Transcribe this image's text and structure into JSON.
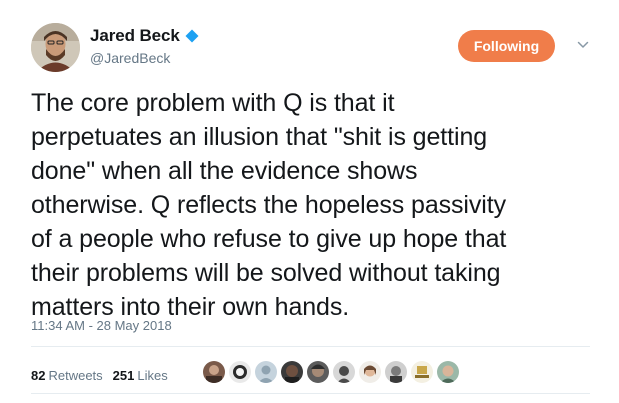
{
  "user": {
    "display_name": "Jared Beck",
    "handle": "@JaredBeck",
    "verified": true
  },
  "follow_button": {
    "label": "Following"
  },
  "tweet": {
    "text": "The core problem with Q is that it\nperpetuates an illusion that \"shit is getting\ndone\" when all the evidence shows\notherwise. Q reflects the hopeless passivity\nof a people who refuse to give up hope that\ntheir problems will be solved without taking\nmatters into their own hands.",
    "timestamp": "11:34 AM - 28 May 2018"
  },
  "stats": {
    "retweets_count": "82",
    "retweets_label": "Retweets",
    "likes_count": "251",
    "likes_label": "Likes"
  },
  "colors": {
    "follow_button": "#f07d4a",
    "verified": "#1da1f2",
    "secondary_text": "#657786"
  },
  "icons": {
    "verified": "verified-badge-icon",
    "caret": "chevron-down-icon"
  }
}
